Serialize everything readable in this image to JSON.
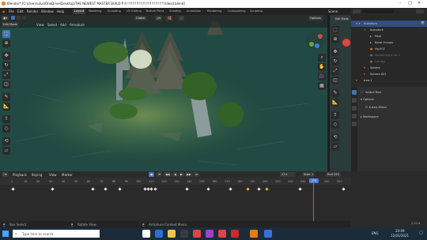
{
  "titlebar": {
    "title": "Blender* [C:\\Users\\ulus\\OneDrive\\Desktop\\THE NEWEST MASTER BUILD P 4 !!!!!!!!!!!!!!!!!!!!!!!!!!!!!\\tilesd.blend]"
  },
  "menu": [
    "File",
    "Edit",
    "Render",
    "Window",
    "Help"
  ],
  "workspaces": [
    "Layout",
    "Modeling",
    "Sculpting",
    "UV Editing",
    "Texture Paint",
    "Shading",
    "Animation",
    "Rendering",
    "Compositing",
    "Scripting"
  ],
  "scene": {
    "scene_label": "Scene",
    "view_layer_label": "View Layer"
  },
  "viewport": {
    "mode": "Edit Mode",
    "menus": [
      "View",
      "Select",
      "Add",
      "Armature"
    ],
    "transform": "Global",
    "options_label": "Options",
    "accent": "#4772b3"
  },
  "outliner": {
    "rows": [
      "Armature",
      "Armature",
      "Pose",
      "Bone Groups",
      "rig-002",
      "Socket arg a rib.v",
      "Lanrtig",
      "Sphere",
      "Sphere.001",
      "tree.1"
    ]
  },
  "properties": {
    "mode": "Edit Mode",
    "item_name": "Select Box",
    "sections": [
      "Options",
      "X-Axis Mirror",
      "Workspace"
    ]
  },
  "timeline": {
    "menus": [
      "Playback",
      "Keying",
      "View",
      "Marker"
    ],
    "current_frame": "274",
    "start_label": "Start",
    "start": "1",
    "end_label": "End",
    "end": "250",
    "ruler": [
      "0",
      "10",
      "20",
      "30",
      "40",
      "50",
      "60",
      "70",
      "80",
      "90",
      "100",
      "110",
      "120",
      "130",
      "140",
      "150",
      "160",
      "170",
      "180",
      "190",
      "200",
      "210",
      "220",
      "230",
      "240",
      "250"
    ],
    "playhead": "274"
  },
  "status": {
    "left": "Box Select",
    "mid": "Rotate View",
    "right": "Armature Context Menu",
    "version": "2.93.4"
  },
  "taskbar": {
    "search_placeholder": "Type here to search",
    "time": "20:09",
    "date": "12/01/2021",
    "lang": "ENG"
  }
}
